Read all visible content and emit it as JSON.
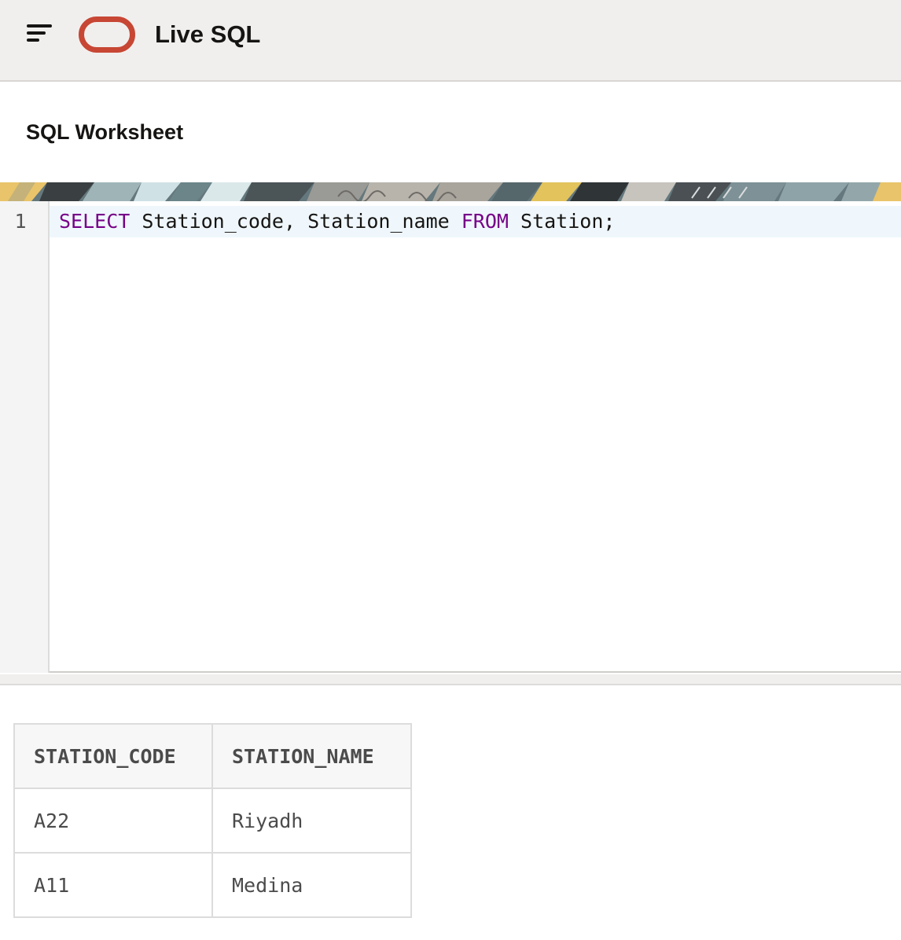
{
  "header": {
    "menu_icon": "hamburger-menu-icon",
    "logo_icon": "oracle-logo-icon",
    "title": "Live SQL",
    "brand_color": "#c74634"
  },
  "page": {
    "title": "SQL Worksheet"
  },
  "editor": {
    "line_numbers": [
      "1"
    ],
    "code": {
      "kw_select": "SELECT",
      "part_columns": " Station_code, Station_name ",
      "kw_from": "FROM",
      "part_table": " Station;"
    },
    "keyword_color": "#770088"
  },
  "results": {
    "columns": [
      "STATION_CODE",
      "STATION_NAME"
    ],
    "rows": [
      [
        "A22",
        "Riyadh"
      ],
      [
        "A11",
        "Medina"
      ]
    ]
  }
}
